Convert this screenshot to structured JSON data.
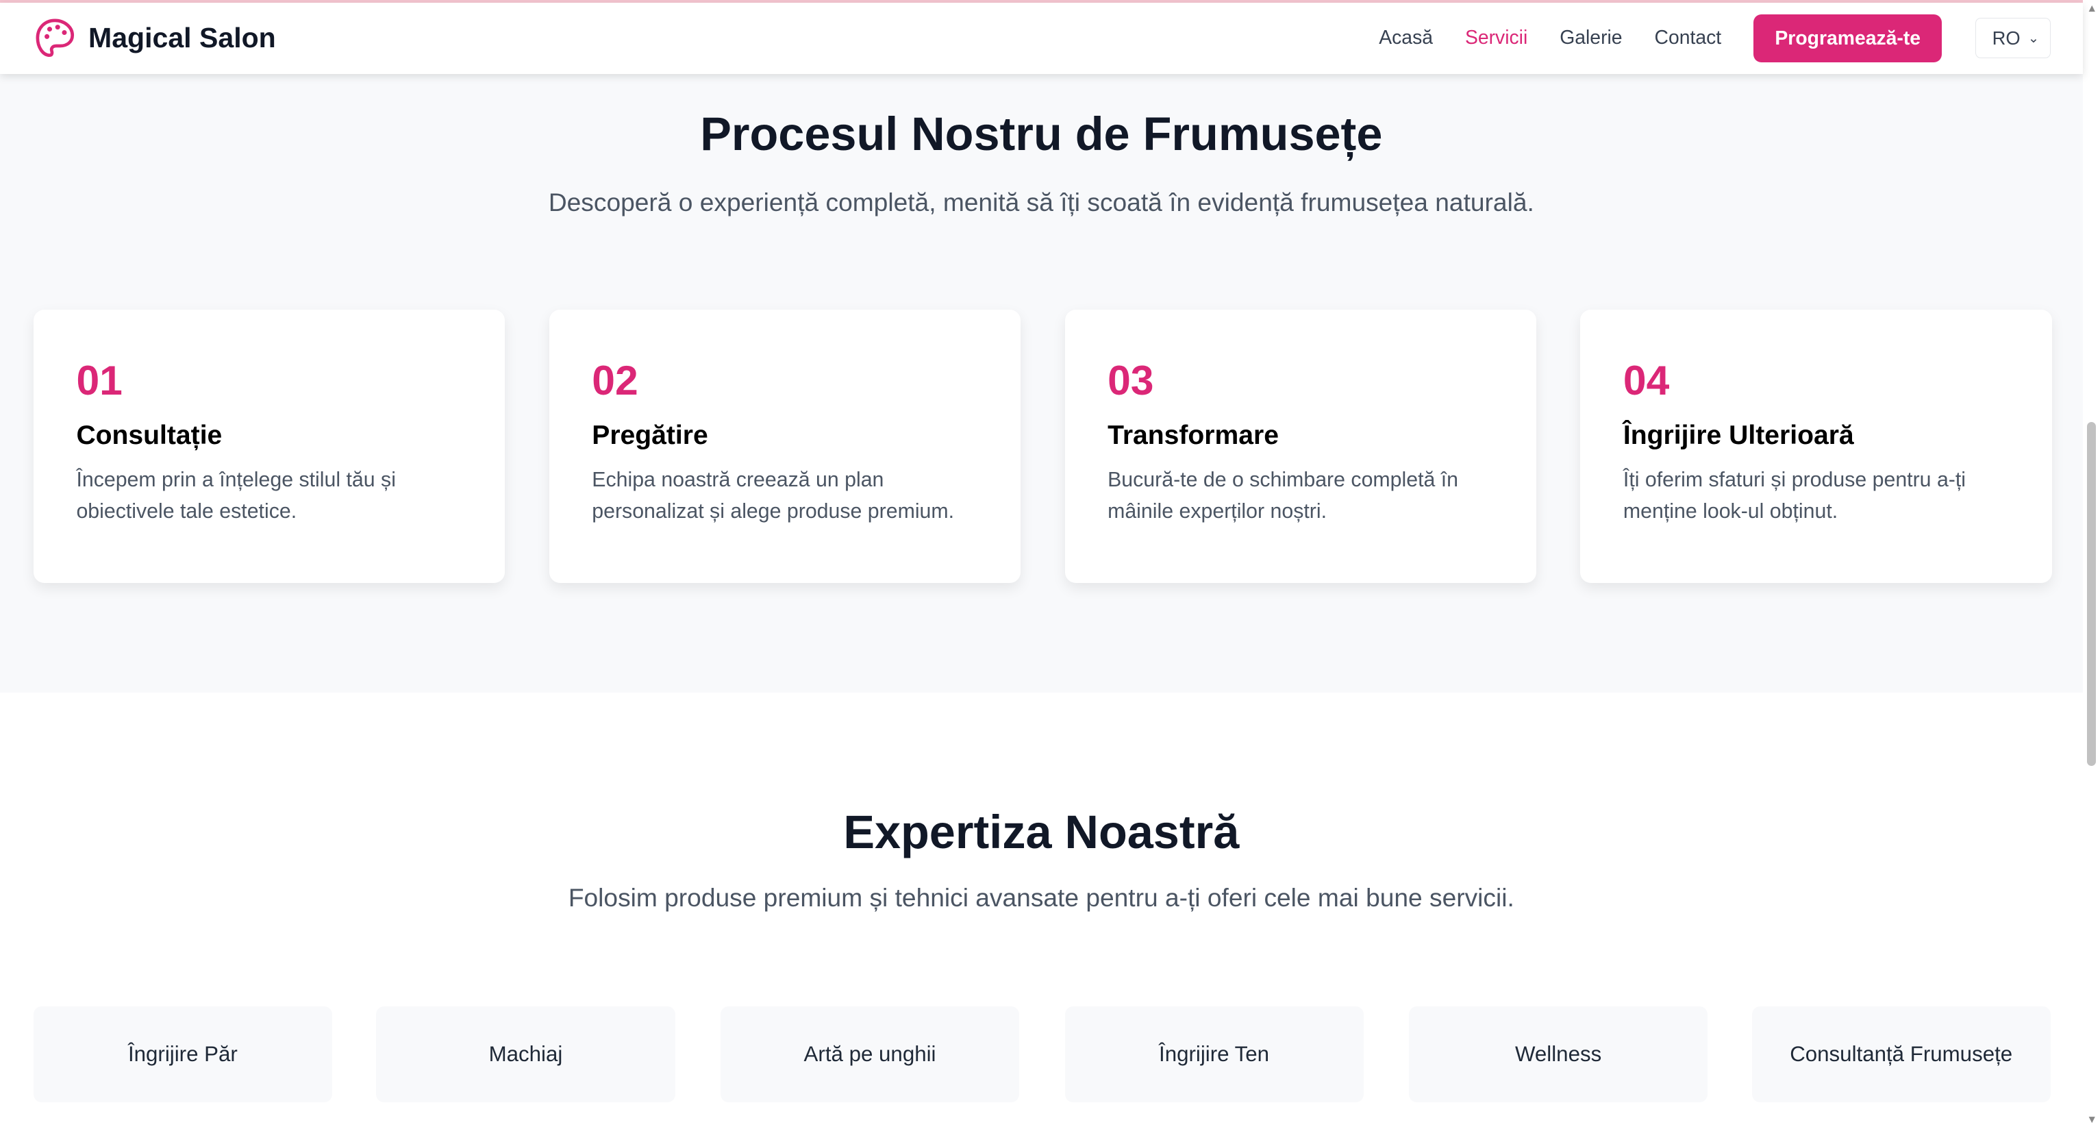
{
  "header": {
    "brand": "Magical Salon",
    "nav": [
      "Acasă",
      "Servicii",
      "Galerie",
      "Contact"
    ],
    "active_nav": "Servicii",
    "cta": "Programează-te",
    "language": "RO",
    "accent": "#db2777"
  },
  "process": {
    "title": "Procesul Nostru de Frumusețe",
    "subtitle": "Descoperă o experiență completă, menită să îți scoată în evidență frumusețea naturală.",
    "steps": [
      {
        "number": "01",
        "title": "Consultație",
        "text": "Începem prin a înțelege stilul tău și obiectivele tale estetice."
      },
      {
        "number": "02",
        "title": "Pregătire",
        "text": "Echipa noastră creează un plan personalizat și alege produse premium."
      },
      {
        "number": "03",
        "title": "Transformare",
        "text": "Bucură-te de o schimbare completă în mâinile experților noștri."
      },
      {
        "number": "04",
        "title": "Îngrijire Ulterioară",
        "text": "Îți oferim sfaturi și produse pentru a-ți menține look-ul obținut."
      }
    ]
  },
  "expertise": {
    "title": "Expertiza Noastră",
    "subtitle": "Folosim produse premium și tehnici avansate pentru a-ți oferi cele mai bune servicii.",
    "items": [
      "Îngrijire Păr",
      "Machiaj",
      "Artă pe unghii",
      "Îngrijire Ten",
      "Wellness",
      "Consultanță Frumusețe"
    ]
  }
}
